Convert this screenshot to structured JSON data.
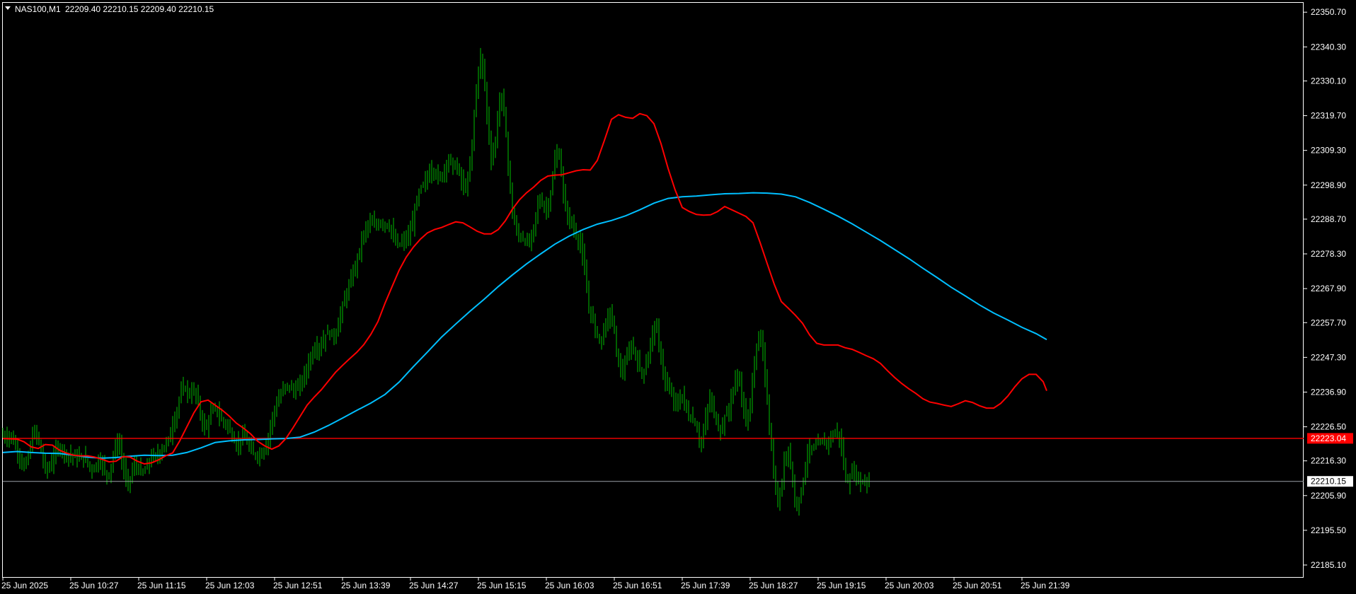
{
  "header": {
    "symbol": "NAS100,M1",
    "ohlc": "22209.40 22210.15 22209.40 22210.15"
  },
  "price_labels": {
    "red_line": "22223.04",
    "bid": "22210.15"
  },
  "colors": {
    "background": "#000000",
    "frame": "#ffffff",
    "candle": "#00c000",
    "ma_fast": "#ff0000",
    "ma_slow": "#00bfff",
    "level_line": "#ff0000",
    "bid_line": "#9aa0a6"
  },
  "chart_data": {
    "type": "line",
    "subtype": "candlestick-with-moving-averages",
    "title": "NAS100,M1",
    "ylim": [
      22181.5,
      22353.5
    ],
    "y_ticks": [
      "22350.70",
      "22340.30",
      "22330.10",
      "22319.70",
      "22309.30",
      "22298.90",
      "22288.70",
      "22278.30",
      "22267.90",
      "22257.70",
      "22247.30",
      "22236.90",
      "22226.50",
      "22216.30",
      "22205.90",
      "22195.50",
      "22185.10"
    ],
    "x_ticks": [
      "25 Jun 2025",
      "25 Jun 10:27",
      "25 Jun 11:15",
      "25 Jun 12:03",
      "25 Jun 12:51",
      "25 Jun 13:39",
      "25 Jun 14:27",
      "25 Jun 15:15",
      "25 Jun 16:03",
      "25 Jun 16:51",
      "25 Jun 17:39",
      "25 Jun 18:27",
      "25 Jun 19:15",
      "25 Jun 20:03",
      "25 Jun 20:51",
      "25 Jun 21:39"
    ],
    "price_x": [
      0,
      5,
      10,
      15,
      20,
      25,
      30,
      35,
      40,
      45,
      50,
      55,
      60,
      65,
      70,
      75,
      80,
      85,
      90,
      95,
      100,
      105,
      110,
      115,
      120,
      125,
      130,
      135,
      140,
      145,
      150,
      155,
      160,
      165,
      170,
      175,
      180,
      185,
      190,
      195,
      200,
      205,
      210,
      215,
      220,
      225,
      230,
      235,
      240,
      245,
      250,
      255,
      260,
      265,
      270,
      275,
      280,
      285,
      290,
      295,
      300,
      305,
      310,
      315,
      320,
      325,
      330,
      335,
      340,
      345,
      350,
      355,
      360,
      365,
      370,
      375,
      380,
      385,
      390,
      395,
      400,
      405,
      410,
      415,
      420,
      425,
      430,
      435,
      440,
      445,
      450,
      455,
      460,
      465,
      470,
      475,
      480,
      485,
      490,
      495,
      500,
      505,
      510,
      515,
      520,
      525,
      530,
      535,
      540,
      545,
      550,
      555,
      560,
      565,
      570,
      575,
      580,
      585,
      590,
      595,
      600,
      605,
      610,
      615,
      620,
      625,
      630,
      635,
      640,
      645,
      650,
      655,
      660,
      665,
      670,
      675,
      680,
      685,
      690,
      695,
      700,
      705,
      710,
      715,
      720,
      725,
      730,
      735,
      740,
      745,
      750,
      755,
      760,
      765,
      770,
      775,
      780,
      785,
      790,
      795,
      800,
      805,
      810,
      815,
      820,
      825,
      830,
      835,
      840,
      845,
      850,
      855,
      860,
      865,
      870,
      875,
      880,
      885,
      890,
      895,
      900,
      905,
      910,
      915,
      920,
      925,
      930,
      935,
      940,
      945,
      950,
      955,
      960,
      965,
      970,
      975,
      980,
      985,
      990,
      995,
      1000,
      1005,
      1010,
      1015,
      1020,
      1025,
      1030,
      1035,
      1040,
      1045,
      1050,
      1055,
      1060,
      1065,
      1070,
      1075,
      1080,
      1085,
      1090,
      1095,
      1100,
      1105,
      1110,
      1115,
      1120,
      1125,
      1130,
      1135,
      1140,
      1145,
      1150,
      1155,
      1160,
      1165,
      1170,
      1175,
      1180,
      1185,
      1190,
      1195,
      1200,
      1205,
      1210,
      1215,
      1220,
      1225,
      1230,
      1235,
      1240,
      1245,
      1250,
      1255,
      1260,
      1265,
      1270,
      1275,
      1280,
      1285,
      1290,
      1295,
      1300,
      1305,
      1310,
      1315,
      1320,
      1325,
      1330,
      1335,
      1340,
      1345,
      1350,
      1355,
      1360,
      1365,
      1370,
      1375,
      1380,
      1385,
      1390,
      1395,
      1400,
      1405,
      1410,
      1415,
      1420,
      1425,
      1430,
      1435,
      1440,
      1445,
      1450,
      1455,
      1460,
      1465,
      1470,
      1475
    ],
    "price_close": [
      22224.0,
      22223.1,
      22224.2,
      22222.0,
      22219.5,
      22216.8,
      22214.1,
      22216.9,
      22221.8,
      22225.2,
      22223.1,
      22218.0,
      22214.2,
      22213.9,
      22216.4,
      22219.3,
      22220.4,
      22219.4,
      22218.2,
      22218.0,
      22217.8,
      22217.2,
      22217.1,
      22217.1,
      22215.6,
      22213.7,
      22214.5,
      22216.3,
      22215.9,
      22212.5,
      22212.3,
      22216.7,
      22221.7,
      22220.7,
      22214.3,
      22209.7,
      22211.1,
      22214.8,
      22214.7,
      22212.8,
      22212.8,
      22215.6,
      22217.1,
      22217.5,
      22218.3,
      22219.7,
      22221.2,
      22223.3,
      22227.0,
      22230.3,
      22235.5,
      22238.5,
      22237.3,
      22236.1,
      22237.2,
      22235.1,
      22229.4,
      22226.0,
      22227.8,
      22231.0,
      22232.2,
      22230.0,
      22228.3,
      22227.6,
      22225.8,
      22223.2,
      22220.8,
      22222.4,
      22224.3,
      22221.7,
      22219.4,
      22218.2,
      22218.0,
      22218.5,
      22219.7,
      22223.3,
      22228.7,
      22232.4,
      22234.6,
      22237.2,
      22239.0,
      22238.7,
      22237.2,
      22237.6,
      22239.2,
      22241.6,
      22244.3,
      22247.5,
      22249.7,
      22250.3,
      22250.8,
      22253.5,
      22254.9,
      22253.8,
      22253.9,
      22258.1,
      22262.7,
      22266.0,
      22269.1,
      22272.6,
      22276.2,
      22280.5,
      22284.3,
      22287.0,
      22287.4,
      22286.9,
      22287.2,
      22287.8,
      22287.2,
      22286.8,
      22284.6,
      22281.6,
      22280.9,
      22282.1,
      22282.9,
      22284.2,
      22288.6,
      22294.5,
      22298.0,
      22299.4,
      22301.2,
      22303.5,
      22303.0,
      22301.1,
      22301.5,
      22304.6,
      22306.5,
      22305.1,
      22304.5,
      22302.6,
      22298.6,
      22298.1,
      22304.2,
      22317.4,
      22330.4,
      22337.1,
      22331.6,
      22317.3,
      22306.7,
      22309.9,
      22321.5,
      22326.0,
      22316.5,
      22302.2,
      22290.9,
      22285.2,
      22283.6,
      22282.8,
      22281.5,
      22281.8,
      22286.4,
      22292.8,
      22294.5,
      22292.0,
      22292.2,
      22297.6,
      22306.1,
      22309.5,
      22300.3,
      22291.6,
      22289.1,
      22286.5,
      22284.0,
      22281.6,
      22277.1,
      22267.0,
      22260.2,
      22258.0,
      22253.9,
      22252.1,
      22255.8,
      22259.9,
      22260.0,
      22253.5,
      22245.3,
      22243.0,
      22245.4,
      22249.3,
      22250.7,
      22247.4,
      22243.6,
      22242.8,
      22245.4,
      22251.9,
      22256.7,
      22254.6,
      22247.1,
      22240.6,
      22237.3,
      22236.7,
      22233.2,
      22233.5,
      22235.9,
      22232.7,
      22228.7,
      22229.0,
      22226.4,
      22221.2,
      22224.6,
      22231.6,
      22235.0,
      22231.1,
      22225.9,
      22226.1,
      22229.2,
      22231.0,
      22236.3,
      22240.0,
      22241.9,
      22234.0,
      22227.2,
      22232.3,
      22241.6,
      22250.7,
      22254.0,
      22246.9,
      22234.3,
      22222.2,
      22210.3,
      22203.2,
      22208.0,
      22217.9,
      22220.1,
      22211.3,
      22203.2,
      22204.9,
      22209.3,
      22216.5,
      22220.2,
      22219.7,
      22220.7,
      22222.2,
      22221.4,
      22222.0,
      22223.5,
      22224.3,
      22225.3,
      22220.2,
      22211.7,
      22209.6,
      22212.6,
      22212.8,
      22210.1,
      22210.2,
      22210.3,
      22210.15
    ],
    "ma_fast_x": [
      0,
      20,
      30,
      40,
      50,
      60,
      70,
      80,
      90,
      100,
      110,
      120,
      130,
      140,
      150,
      160,
      170,
      180,
      190,
      200,
      210,
      220,
      230,
      240,
      250,
      260,
      270,
      280,
      290,
      300,
      310,
      320,
      330,
      340,
      350,
      360,
      370,
      380,
      390,
      400,
      410,
      420,
      430,
      440,
      450,
      460,
      470,
      480,
      490,
      500,
      510,
      520,
      530,
      540,
      550,
      560,
      570,
      580,
      590,
      600,
      610,
      620,
      630,
      640,
      650,
      660,
      670,
      680,
      690,
      700,
      710,
      720,
      730,
      740,
      750,
      760,
      770,
      780,
      790,
      800,
      810,
      820,
      830,
      840,
      850,
      860,
      870,
      880,
      890,
      900,
      910,
      920,
      930,
      940,
      950,
      960,
      970,
      980,
      990,
      1000,
      1010,
      1020,
      1030,
      1040,
      1050,
      1060,
      1070,
      1080,
      1090,
      1100,
      1110,
      1120,
      1130,
      1140,
      1150,
      1160,
      1170,
      1180,
      1190,
      1200,
      1210,
      1220,
      1230,
      1240,
      1250,
      1260,
      1270,
      1280,
      1290,
      1300,
      1310,
      1320,
      1330,
      1340,
      1350,
      1360,
      1370,
      1380,
      1390,
      1400,
      1410,
      1420,
      1430,
      1440,
      1450,
      1460,
      1470,
      1475
    ],
    "ma_fast_y": [
      22223.0,
      22222.8,
      22222.0,
      22220.5,
      22220.0,
      22221.2,
      22221.0,
      22219.5,
      22218.6,
      22218.0,
      22217.8,
      22217.8,
      22217.4,
      22216.8,
      22216.0,
      22216.2,
      22217.6,
      22217.4,
      22216.2,
      22215.4,
      22215.7,
      22216.6,
      22217.8,
      22218.7,
      22222.3,
      22226.5,
      22230.7,
      22234.0,
      22234.5,
      22233.0,
      22231.5,
      22229.7,
      22227.6,
      22226.1,
      22224.4,
      22222.2,
      22220.8,
      22219.8,
      22220.8,
      22223.0,
      22226.2,
      22229.6,
      22233.0,
      22235.4,
      22237.6,
      22240.2,
      22242.8,
      22244.9,
      22246.9,
      22248.8,
      22251.1,
      22254.2,
      22258.0,
      22263.5,
      22268.5,
      22273.4,
      22277.3,
      22280.3,
      22282.7,
      22284.6,
      22285.6,
      22286.2,
      22287.1,
      22287.9,
      22287.6,
      22286.4,
      22285.1,
      22284.3,
      22284.3,
      22285.6,
      22288.2,
      22291.7,
      22294.5,
      22296.6,
      22298.3,
      22300.3,
      22301.6,
      22301.9,
      22302.0,
      22302.6,
      22303.2,
      22303.5,
      22303.4,
      22306.3,
      22312.3,
      22318.6,
      22320.0,
      22319.2,
      22318.9,
      22320.3,
      22319.7,
      22317.3,
      22311.3,
      22303.9,
      22297.4,
      22292.2,
      22291.0,
      22290.1,
      22289.9,
      22290.0,
      22291.0,
      22292.5,
      22291.5,
      22290.5,
      22289.5,
      22287.6,
      22281.7,
      22275.4,
      22269.2,
      22264.0,
      22262.0,
      22259.9,
      22257.5,
      22254.0,
      22251.5,
      22251.0,
      22251.0,
      22251.0,
      22250.2,
      22249.7,
      22248.8,
      22247.8,
      22246.9,
      22245.5,
      22243.3,
      22241.3,
      22239.5,
      22237.9,
      22236.5,
      22234.9,
      22233.9,
      22233.5,
      22233.0,
      22232.6,
      22233.4,
      22234.3,
      22233.8,
      22232.8,
      22232.1,
      22232.1,
      22233.5,
      22235.7,
      22238.5,
      22240.9,
      22242.2,
      22242.2,
      22240.0,
      22237.3
    ],
    "ma_slow_x": [
      0,
      20,
      40,
      60,
      80,
      100,
      120,
      140,
      160,
      180,
      200,
      220,
      240,
      260,
      280,
      300,
      320,
      340,
      360,
      380,
      400,
      420,
      440,
      460,
      480,
      500,
      520,
      540,
      560,
      580,
      600,
      620,
      640,
      660,
      680,
      700,
      720,
      740,
      760,
      780,
      800,
      820,
      840,
      860,
      880,
      900,
      920,
      940,
      960,
      980,
      1000,
      1020,
      1040,
      1060,
      1080,
      1100,
      1120,
      1140,
      1160,
      1180,
      1200,
      1220,
      1240,
      1260,
      1280,
      1300,
      1320,
      1340,
      1360,
      1380,
      1400,
      1420,
      1440,
      1460,
      1475
    ],
    "ma_slow_y": [
      22218.8,
      22219.1,
      22218.8,
      22218.6,
      22218.5,
      22218.0,
      22217.4,
      22217.1,
      22217.3,
      22217.7,
      22218.0,
      22217.9,
      22218.0,
      22218.8,
      22220.2,
      22221.8,
      22222.3,
      22222.6,
      22222.7,
      22222.9,
      22223.0,
      22223.4,
      22224.9,
      22226.9,
      22229.1,
      22231.4,
      22233.6,
      22236.2,
      22239.9,
      22244.5,
      22248.9,
      22253.4,
      22257.3,
      22261.1,
      22264.7,
      22268.5,
      22272.0,
      22275.3,
      22278.3,
      22281.2,
      22283.6,
      22285.6,
      22287.2,
      22288.3,
      22289.7,
      22291.5,
      22293.5,
      22294.9,
      22295.4,
      22295.6,
      22296.0,
      22296.3,
      22296.4,
      22296.6,
      22296.5,
      22296.2,
      22295.4,
      22293.7,
      22291.7,
      22289.6,
      22287.3,
      22284.8,
      22282.3,
      22279.6,
      22276.9,
      22274.0,
      22271.2,
      22268.3,
      22265.7,
      22263.0,
      22260.6,
      22258.5,
      22256.3,
      22254.4,
      22252.6
    ],
    "level_line_value": 22223.04,
    "bid_value": 22210.15
  }
}
